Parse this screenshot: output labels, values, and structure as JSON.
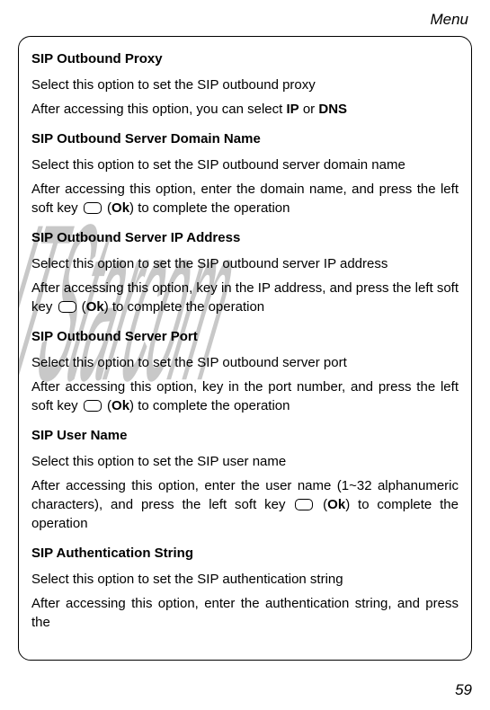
{
  "header": {
    "chapter": "Menu"
  },
  "watermark": "UTStarcom",
  "sections": [
    {
      "heading": "SIP Outbound Proxy",
      "paragraphs": [
        {
          "text": "Select this option to set the SIP outbound proxy"
        },
        {
          "parts": [
            "After accessing this option, you can select ",
            {
              "bold": "IP"
            },
            " or ",
            {
              "bold": "DNS"
            }
          ]
        }
      ]
    },
    {
      "heading": "SIP Outbound Server Domain Name",
      "paragraphs": [
        {
          "text": "Select this option to set the SIP outbound server domain name"
        },
        {
          "parts": [
            "After accessing this option, enter the domain name, and press the left soft key ",
            {
              "icon": "softkey"
            },
            " (",
            {
              "bold": "Ok"
            },
            ") to complete the operation"
          ]
        }
      ]
    },
    {
      "heading": "SIP Outbound Server IP Address",
      "paragraphs": [
        {
          "text": "Select this option to set the SIP outbound server IP address"
        },
        {
          "parts": [
            "After accessing this option, key in the IP address, and press the left soft key ",
            {
              "icon": "softkey"
            },
            " (",
            {
              "bold": "Ok"
            },
            ") to complete the operation"
          ]
        }
      ]
    },
    {
      "heading": "SIP Outbound Server Port",
      "paragraphs": [
        {
          "text": "Select this option to set the SIP outbound server port"
        },
        {
          "parts": [
            "After accessing this option, key in the port number, and press the left soft key ",
            {
              "icon": "softkey"
            },
            " (",
            {
              "bold": "Ok"
            },
            ") to complete the operation"
          ]
        }
      ]
    },
    {
      "heading": "SIP User Name",
      "paragraphs": [
        {
          "text": "Select this option to set the SIP user name"
        },
        {
          "parts": [
            "After accessing this option, enter the user name (1~32 alphanumeric characters), and press the left soft key ",
            {
              "icon": "softkey"
            },
            " (",
            {
              "bold": "Ok"
            },
            ") to complete the operation"
          ]
        }
      ]
    },
    {
      "heading": "SIP Authentication String",
      "paragraphs": [
        {
          "text": "Select this option to set the SIP authentication string"
        },
        {
          "parts": [
            "After accessing this option, enter the authentication string, and press the"
          ]
        }
      ]
    }
  ],
  "page_number": "59"
}
